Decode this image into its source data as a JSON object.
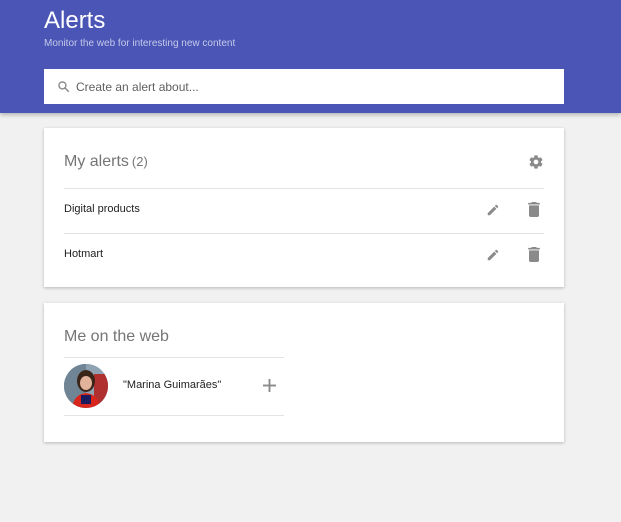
{
  "header": {
    "title": "Alerts",
    "subtitle": "Monitor the web for interesting new content",
    "background_color": "#4a55b6"
  },
  "search": {
    "placeholder": "Create an alert about...",
    "value": "",
    "icon": "search-icon"
  },
  "my_alerts": {
    "title": "My alerts",
    "count": "(2)",
    "settings_icon": "gear-icon",
    "items": [
      {
        "label": "Digital products",
        "edit_icon": "pencil-icon",
        "delete_icon": "trash-icon"
      },
      {
        "label": "Hotmart",
        "edit_icon": "pencil-icon",
        "delete_icon": "trash-icon"
      }
    ]
  },
  "me_on_web": {
    "title": "Me on the web",
    "person": {
      "name": "\"Marina Guimarães\"",
      "avatar": "avatar",
      "add_icon": "plus-icon"
    }
  }
}
